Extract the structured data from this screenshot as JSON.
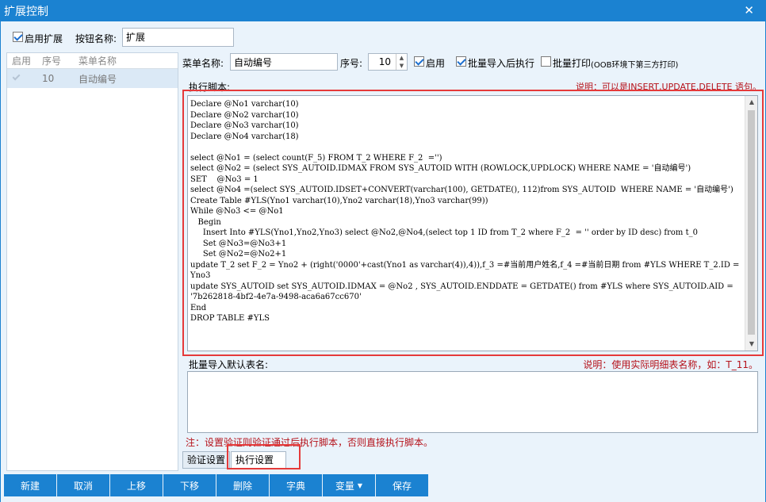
{
  "window": {
    "title": "扩展控制",
    "close_glyph": "✕"
  },
  "topbar": {
    "enable_ext_label": "启用扩展",
    "enable_ext_checked": true,
    "button_name_label": "按钮名称:",
    "button_name_value": "扩展"
  },
  "grid": {
    "headers": [
      "启用",
      "序号",
      "菜单名称"
    ],
    "rows": [
      {
        "enabled": true,
        "seq": "10",
        "name": "自动编号"
      }
    ]
  },
  "form": {
    "menu_name_label": "菜单名称:",
    "menu_name_value": "自动编号",
    "seq_label": "序号:",
    "seq_value": "10",
    "enable_label": "启用",
    "enable_checked": true,
    "batch_after_label": "批量导入后执行",
    "batch_after_checked": true,
    "batch_print_label": "批量打印",
    "batch_print_note": "(OOB环境下第三方打印)",
    "batch_print_checked": false
  },
  "script": {
    "label": "执行脚本:",
    "note": "说明：可以是INSERT,UPDATE,DELETE 语句。",
    "content": "Declare @No1 varchar(10)\nDeclare @No2 varchar(10)\nDeclare @No3 varchar(10)\nDeclare @No4 varchar(18)\n\nselect @No1 = (select count(F_5) FROM T_2 WHERE F_2  ='')\nselect @No2 = (select SYS_AUTOID.IDMAX FROM SYS_AUTOID WITH (ROWLOCK,UPDLOCK) WHERE NAME = '自动编号')\nSET    @No3 = 1\nselect @No4 =(select SYS_AUTOID.IDSET+CONVERT(varchar(100), GETDATE(), 112)from SYS_AUTOID  WHERE NAME = '自动编号')\nCreate Table #YLS(Yno1 varchar(10),Yno2 varchar(18),Yno3 varchar(99))\nWhile @No3 <= @No1\n   Begin\n     Insert Into #YLS(Yno1,Yno2,Yno3) select @No2,@No4,(select top 1 ID from T_2 where F_2  = '' order by ID desc) from t_0\n     Set @No3=@No3+1\n     Set @No2=@No2+1\nupdate T_2 set F_2 = Yno2 + (right('0000'+cast(Yno1 as varchar(4)),4)),f_3 =#当前用户姓名,f_4 =#当前日期 from #YLS WHERE T_2.ID = Yno3\nupdate SYS_AUTOID set SYS_AUTOID.IDMAX = @No2 , SYS_AUTOID.ENDDATE = GETDATE() from #YLS where SYS_AUTOID.AID = '7b262818-4bf2-4e7a-9498-aca6a67cc670'\nEnd\nDROP TABLE #YLS"
  },
  "batch_table": {
    "label": "批量导入默认表名:",
    "note": "说明：使用实际明细表名称，如：T_11。",
    "value": ""
  },
  "footer_note": "注：设置验证则验证通过后执行脚本，否则直接执行脚本。",
  "tabs": [
    "验证设置",
    "执行设置"
  ],
  "buttons": [
    "新建",
    "取消",
    "上移",
    "下移",
    "删除",
    "字典",
    "变量",
    "保存"
  ],
  "colors": {
    "accent": "#1b82d1",
    "highlight_border": "#e53a3a",
    "note_text": "#b5121b"
  }
}
